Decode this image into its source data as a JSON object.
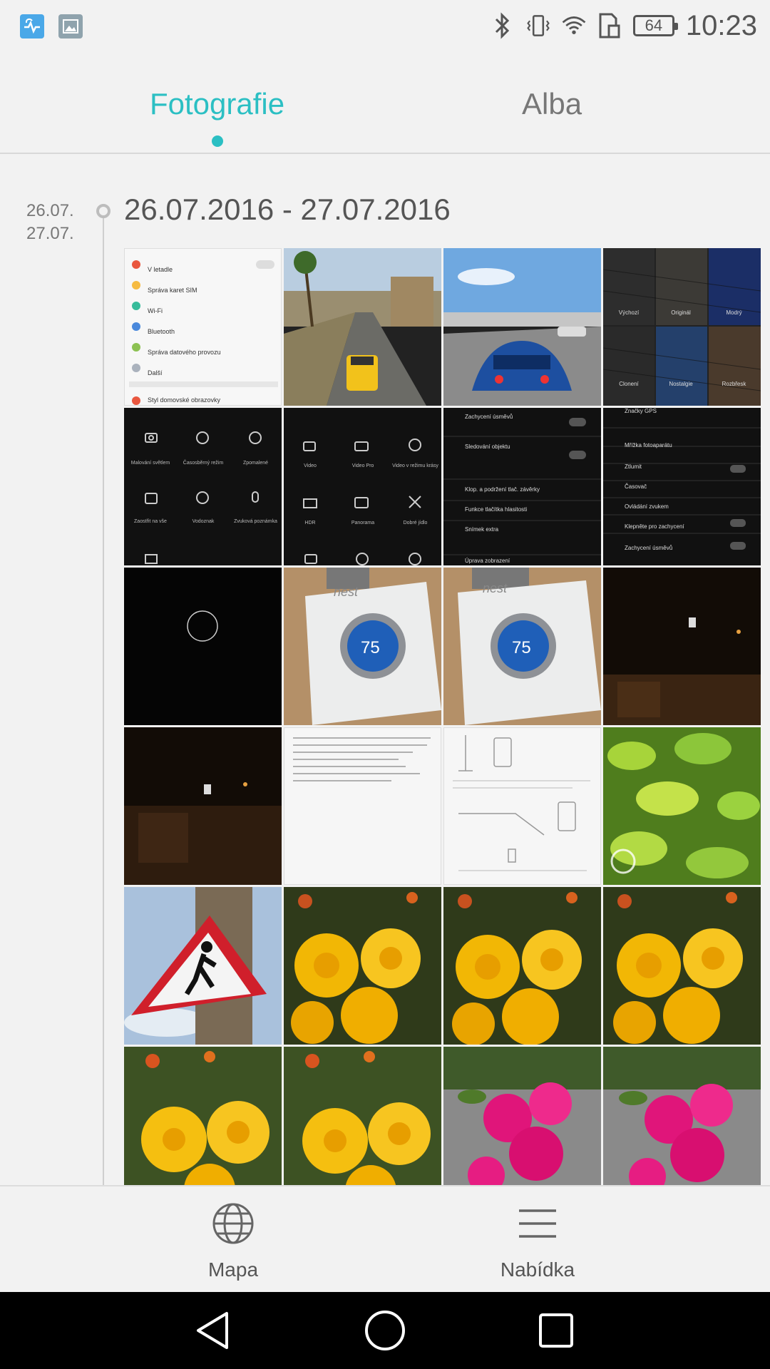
{
  "status_bar": {
    "left_icons": [
      "health-app-icon",
      "gallery-app-icon"
    ],
    "right_icons": [
      "bluetooth-icon",
      "vibrate-icon",
      "wifi-icon",
      "sim-icon"
    ],
    "battery_level": "64",
    "time": "10:23"
  },
  "tabs": [
    {
      "label": "Fotografie",
      "active": true
    },
    {
      "label": "Alba",
      "active": false
    }
  ],
  "timeline": {
    "side_dates": [
      "26.07.",
      "27.07."
    ],
    "range_title": "26.07.2016 - 27.07.2016"
  },
  "thumbnails": [
    {
      "label": "settings-screenshot",
      "bg": "#f4f4f4",
      "lines": [
        "V letadle",
        "Správa karet SIM",
        "Wi-Fi",
        "Bluetooth",
        "Správa datového provozu",
        "Další",
        "Styl domovské obrazovky"
      ]
    },
    {
      "label": "game-taxi-street",
      "bg": "#8a8a72"
    },
    {
      "label": "game-racing-car",
      "bg": "#4a77b5"
    },
    {
      "label": "keyboard-filters",
      "bg": "#1b2233",
      "lines": [
        "Výchozí",
        "Originál",
        "Modrý",
        "Clonení",
        "Nostalgie",
        "Rozbřesk"
      ]
    },
    {
      "label": "camera-modes-1",
      "bg": "#111111",
      "lines": [
        "Malování světlem",
        "Časosběrný režim",
        "Zpomalené",
        "Zaostřit na vše",
        "Vodoznak",
        "Zvuková poznámka"
      ]
    },
    {
      "label": "camera-modes-2",
      "bg": "#111111",
      "lines": [
        "Video",
        "Video Pro",
        "Video v režimu krásy",
        "HDR",
        "Panorama",
        "Dobré jídlo"
      ]
    },
    {
      "label": "camera-settings-1",
      "bg": "#111111",
      "lines": [
        "Zachycení úsměvů",
        "Sledování objektu",
        "Klop. a podržení tlač. závěrky",
        "Funkce tlačítka hlasitosti",
        "Snímek extra",
        "Úprava zobrazení"
      ]
    },
    {
      "label": "camera-settings-2",
      "bg": "#111111",
      "lines": [
        "Značky GPS",
        "Mřížka fotoaparátu",
        "Ztlumit",
        "Časovač",
        "Ovládání zvukem",
        "Klepněte pro zachycení",
        "Zachycení úsměvů"
      ]
    },
    {
      "label": "dark-circle",
      "bg": "#050505"
    },
    {
      "label": "nest-thermostat-1",
      "bg": "#b08d63"
    },
    {
      "label": "nest-thermostat-2",
      "bg": "#b08d63"
    },
    {
      "label": "night-church-1",
      "bg": "#120c06"
    },
    {
      "label": "night-church-2",
      "bg": "#120c06"
    },
    {
      "label": "text-document",
      "bg": "#f6f6f6"
    },
    {
      "label": "wifi-diagram",
      "bg": "#f6f6f6"
    },
    {
      "label": "green-leaves",
      "bg": "#6fa228"
    },
    {
      "label": "pedestrian-sign",
      "bg": "#8aa6c9"
    },
    {
      "label": "yellow-flowers-1",
      "bg": "#3a3a22"
    },
    {
      "label": "yellow-flowers-2",
      "bg": "#3a3a22"
    },
    {
      "label": "yellow-flowers-3",
      "bg": "#3a3a22"
    },
    {
      "label": "yellow-flowers-4",
      "bg": "#4a5a28"
    },
    {
      "label": "yellow-flowers-5",
      "bg": "#4a5a28"
    },
    {
      "label": "pink-flowers-1",
      "bg": "#6e6e6e"
    },
    {
      "label": "pink-flowers-2",
      "bg": "#6e6e6e"
    }
  ],
  "bottom_bar": {
    "map_label": "Mapa",
    "menu_label": "Nabídka"
  },
  "colors": {
    "accent": "#2bbfc3",
    "background": "#f2f2f2",
    "text": "#555555"
  }
}
